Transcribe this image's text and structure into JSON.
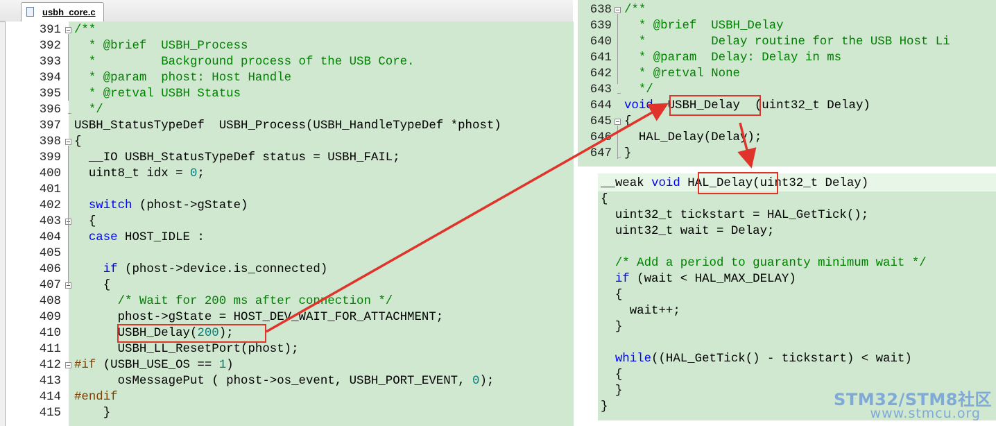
{
  "tab": {
    "filename": "usbh_core.c"
  },
  "left_panel": {
    "lines": [
      {
        "num": "391",
        "code": [
          [
            "/**",
            "comment"
          ]
        ]
      },
      {
        "num": "392",
        "code": [
          [
            "  * @brief  USBH_Process",
            "comment"
          ]
        ]
      },
      {
        "num": "393",
        "code": [
          [
            "  *         Background process of the USB Core.",
            "comment"
          ]
        ]
      },
      {
        "num": "394",
        "code": [
          [
            "  * @param  phost: Host Handle",
            "comment"
          ]
        ]
      },
      {
        "num": "395",
        "code": [
          [
            "  * @retval USBH Status",
            "comment"
          ]
        ]
      },
      {
        "num": "396",
        "code": [
          [
            "  */",
            "comment"
          ]
        ]
      },
      {
        "num": "397",
        "code": [
          [
            "USBH_StatusTypeDef  USBH_Process(USBH_HandleTypeDef *phost)",
            ""
          ]
        ]
      },
      {
        "num": "398",
        "code": [
          [
            "{",
            ""
          ]
        ]
      },
      {
        "num": "399",
        "code": [
          [
            "  __IO USBH_StatusTypeDef status = USBH_FAIL;",
            ""
          ]
        ]
      },
      {
        "num": "400",
        "code": [
          [
            "  uint8_t idx = ",
            ""
          ],
          [
            "0",
            "num"
          ],
          [
            ";",
            ""
          ]
        ]
      },
      {
        "num": "401",
        "code": []
      },
      {
        "num": "402",
        "code": [
          [
            "  ",
            ""
          ],
          [
            "switch",
            "kw"
          ],
          [
            " (phost->gState)",
            ""
          ]
        ]
      },
      {
        "num": "403",
        "code": [
          [
            "  {",
            ""
          ]
        ]
      },
      {
        "num": "404",
        "code": [
          [
            "  ",
            ""
          ],
          [
            "case",
            "kw"
          ],
          [
            " HOST_IDLE :",
            ""
          ]
        ]
      },
      {
        "num": "405",
        "code": []
      },
      {
        "num": "406",
        "code": [
          [
            "    ",
            ""
          ],
          [
            "if",
            "kw"
          ],
          [
            " (phost->device.is_connected)",
            ""
          ]
        ]
      },
      {
        "num": "407",
        "code": [
          [
            "    {",
            ""
          ]
        ]
      },
      {
        "num": "408",
        "code": [
          [
            "      ",
            ""
          ],
          [
            "/* Wait for 200 ms after connection */",
            "comment"
          ]
        ]
      },
      {
        "num": "409",
        "code": [
          [
            "      phost->gState = HOST_DEV_WAIT_FOR_ATTACHMENT;",
            ""
          ]
        ]
      },
      {
        "num": "410",
        "code": [
          [
            "      USBH_Delay(",
            ""
          ],
          [
            "200",
            "num"
          ],
          [
            ");",
            ""
          ]
        ]
      },
      {
        "num": "411",
        "code": [
          [
            "      USBH_LL_ResetPort(phost);",
            ""
          ]
        ]
      },
      {
        "num": "412",
        "code": [
          [
            "#if",
            "pp"
          ],
          [
            " (USBH_USE_OS == ",
            ""
          ],
          [
            "1",
            "num"
          ],
          [
            ")",
            ""
          ]
        ]
      },
      {
        "num": "413",
        "code": [
          [
            "      osMessagePut ( phost->os_event, USBH_PORT_EVENT, ",
            ""
          ],
          [
            "0",
            "num"
          ],
          [
            ");",
            ""
          ]
        ]
      },
      {
        "num": "414",
        "code": [
          [
            "#endif",
            "pp"
          ]
        ]
      },
      {
        "num": "415",
        "code": [
          [
            "    }",
            ""
          ]
        ]
      }
    ]
  },
  "right_top_panel": {
    "lines": [
      {
        "num": "638",
        "code": [
          [
            "/**",
            "comment"
          ]
        ]
      },
      {
        "num": "639",
        "code": [
          [
            "  * @brief  USBH_Delay",
            "comment"
          ]
        ]
      },
      {
        "num": "640",
        "code": [
          [
            "  *         Delay routine for the USB Host Li",
            "comment"
          ]
        ]
      },
      {
        "num": "641",
        "code": [
          [
            "  * @param  Delay: Delay in ms",
            "comment"
          ]
        ]
      },
      {
        "num": "642",
        "code": [
          [
            "  * @retval None",
            "comment"
          ]
        ]
      },
      {
        "num": "643",
        "code": [
          [
            "  */",
            "comment"
          ]
        ]
      },
      {
        "num": "644",
        "code": [
          [
            "void",
            "kw"
          ],
          [
            "  USBH_Delay  (uint32_t Delay)",
            ""
          ]
        ]
      },
      {
        "num": "645",
        "code": [
          [
            "{",
            ""
          ]
        ]
      },
      {
        "num": "646",
        "code": [
          [
            "  HAL_Delay(Delay);",
            ""
          ]
        ]
      },
      {
        "num": "647",
        "code": [
          [
            "}",
            ""
          ]
        ]
      }
    ]
  },
  "right_bottom_panel": {
    "lines": [
      {
        "code": [
          [
            "__weak ",
            ""
          ],
          [
            "void",
            "kw"
          ],
          [
            " HAL_Delay(uint32_t Delay)",
            ""
          ]
        ]
      },
      {
        "code": [
          [
            "{",
            ""
          ]
        ]
      },
      {
        "code": [
          [
            "  uint32_t tickstart = HAL_GetTick();",
            ""
          ]
        ]
      },
      {
        "code": [
          [
            "  uint32_t wait = Delay;",
            ""
          ]
        ]
      },
      {
        "code": []
      },
      {
        "code": [
          [
            "  ",
            ""
          ],
          [
            "/* Add a period to guaranty minimum wait */",
            "comment"
          ]
        ]
      },
      {
        "code": [
          [
            "  ",
            ""
          ],
          [
            "if",
            "kw"
          ],
          [
            " (wait < HAL_MAX_DELAY)",
            ""
          ]
        ]
      },
      {
        "code": [
          [
            "  {",
            ""
          ]
        ]
      },
      {
        "code": [
          [
            "    wait++;",
            ""
          ]
        ]
      },
      {
        "code": [
          [
            "  }",
            ""
          ]
        ]
      },
      {
        "code": []
      },
      {
        "code": [
          [
            "  ",
            ""
          ],
          [
            "while",
            "kw"
          ],
          [
            "((HAL_GetTick() - tickstart) < wait)",
            ""
          ]
        ]
      },
      {
        "code": [
          [
            "  {",
            ""
          ]
        ]
      },
      {
        "code": [
          [
            "  }",
            ""
          ]
        ]
      },
      {
        "code": [
          [
            "}",
            ""
          ]
        ]
      }
    ]
  },
  "watermark": {
    "brand": "STM32/STM8社区",
    "url": "www.stmcu.org"
  },
  "colors": {
    "code_background": "#cfe8cf",
    "comment": "#008000",
    "keyword": "#0000ff",
    "number": "#008080",
    "preprocessor": "#804000",
    "highlight_box": "#e0332b",
    "watermark": "#7fa9d6"
  },
  "icons": {
    "file_tab": "document-icon"
  }
}
